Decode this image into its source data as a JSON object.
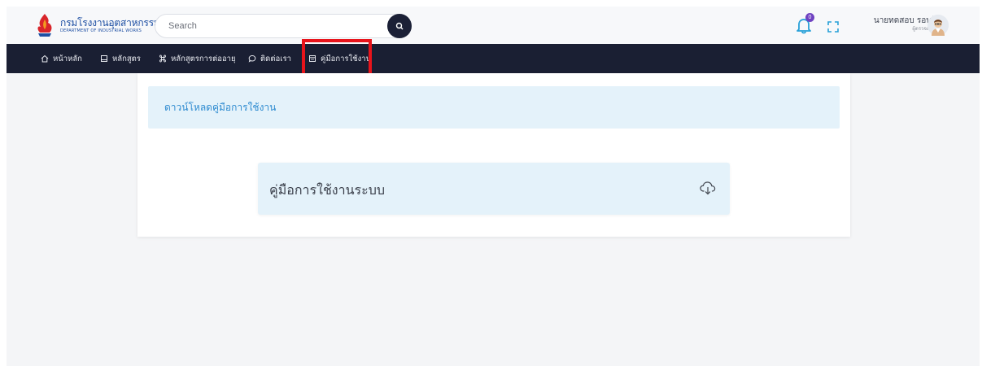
{
  "header": {
    "logo_thai": "กรมโรงงานอุตสาหกรรม",
    "logo_english": "DEPARTMENT OF INDUSTRIAL WORKS",
    "search_placeholder": "Search",
    "notification_count": "0",
    "user_name": "นายทดสอบ รอบรู้",
    "user_role": "ผู้ตรวจสอบ"
  },
  "nav": {
    "items": [
      {
        "label": "หน้าหลัก",
        "icon": "home-icon"
      },
      {
        "label": "หลักสูตร",
        "icon": "book-icon"
      },
      {
        "label": "หลักสูตรการต่ออายุ",
        "icon": "command-icon"
      },
      {
        "label": "ติดต่อเรา",
        "icon": "chat-icon"
      },
      {
        "label": "คู่มือการใช้งาน",
        "icon": "manual-icon"
      }
    ]
  },
  "main": {
    "banner": "ดาวน์โหลดคู่มือการใช้งาน",
    "manual_label": "คู่มือการใช้งานระบบ"
  },
  "colors": {
    "navbar": "#1a1f33",
    "banner_bg": "#e4f2fa",
    "banner_text": "#2e8bd0",
    "highlight": "#e8141b"
  }
}
